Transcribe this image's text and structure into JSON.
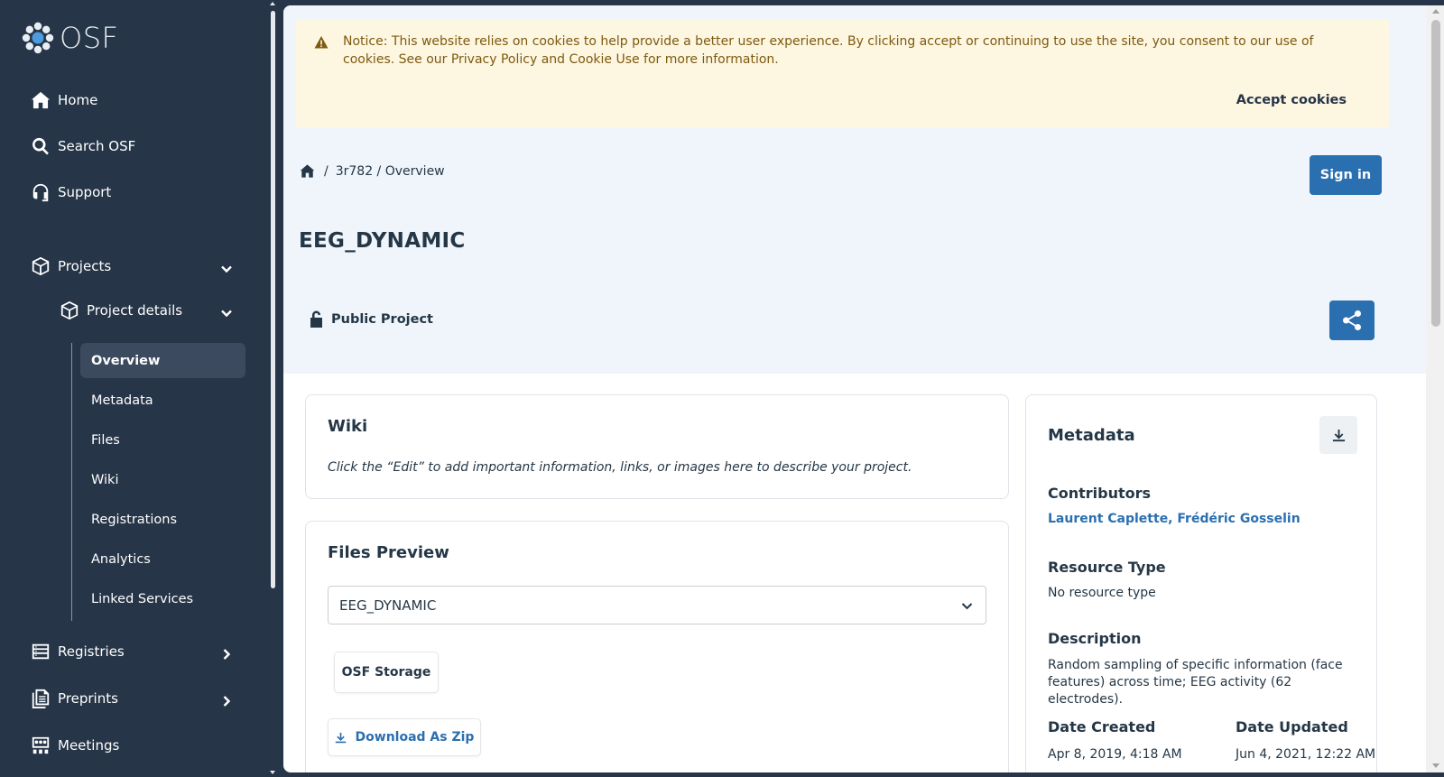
{
  "brand": {
    "name": "OSF"
  },
  "sidebar": {
    "nav": [
      {
        "label": "Home",
        "icon": "home-icon"
      },
      {
        "label": "Search OSF",
        "icon": "search-icon"
      },
      {
        "label": "Support",
        "icon": "headset-icon"
      }
    ],
    "projects": {
      "label": "Projects",
      "icon": "cube-icon"
    },
    "project_details": {
      "label": "Project details",
      "icon": "cube-icon"
    },
    "sub_items": [
      "Overview",
      "Metadata",
      "Files",
      "Wiki",
      "Registrations",
      "Analytics",
      "Linked Services"
    ],
    "active_sub_item": "Overview",
    "registries": {
      "label": "Registries",
      "icon": "registries-icon"
    },
    "preprints": {
      "label": "Preprints",
      "icon": "preprints-icon"
    },
    "meetings": {
      "label": "Meetings",
      "icon": "meetings-icon"
    }
  },
  "cookie_banner": {
    "text": "Notice: This website relies on cookies to help provide a better user experience. By clicking accept or continuing to use the site, you consent to our use of cookies. See our Privacy Policy and Cookie Use for more information.",
    "accept_label": "Accept cookies",
    "bg_color": "#fdf6e1",
    "text_color": "#7e5a10"
  },
  "header": {
    "breadcrumb_sep": "/",
    "breadcrumb": "3r782 / Overview",
    "signin_label": "Sign in",
    "project_title": "EEG_DYNAMIC",
    "visibility": "Public Project"
  },
  "wiki": {
    "title": "Wiki",
    "text": "Click the “Edit” to add important information, links, or images here to describe your project."
  },
  "files_preview": {
    "title": "Files Preview",
    "selected_project": "EEG_DYNAMIC",
    "storage_label": "OSF Storage",
    "download_zip_label": "Download As Zip"
  },
  "metadata": {
    "title": "Metadata",
    "contributors_label": "Contributors",
    "contributors": "Laurent Caplette, Frédéric Gosselin",
    "resource_type_label": "Resource Type",
    "resource_type": "No resource type",
    "description_label": "Description",
    "description": "Random sampling of specific information (face features) across time; EEG activity (62 electrodes).",
    "date_created_label": "Date Created",
    "date_created": "Apr 8, 2019, 4:18 AM",
    "date_updated_label": "Date Updated",
    "date_updated": "Jun 4, 2021, 12:22 AM"
  },
  "colors": {
    "sidebar_bg": "#263548",
    "accent": "#2a6fb0",
    "hero_bg": "#eff5fb"
  }
}
